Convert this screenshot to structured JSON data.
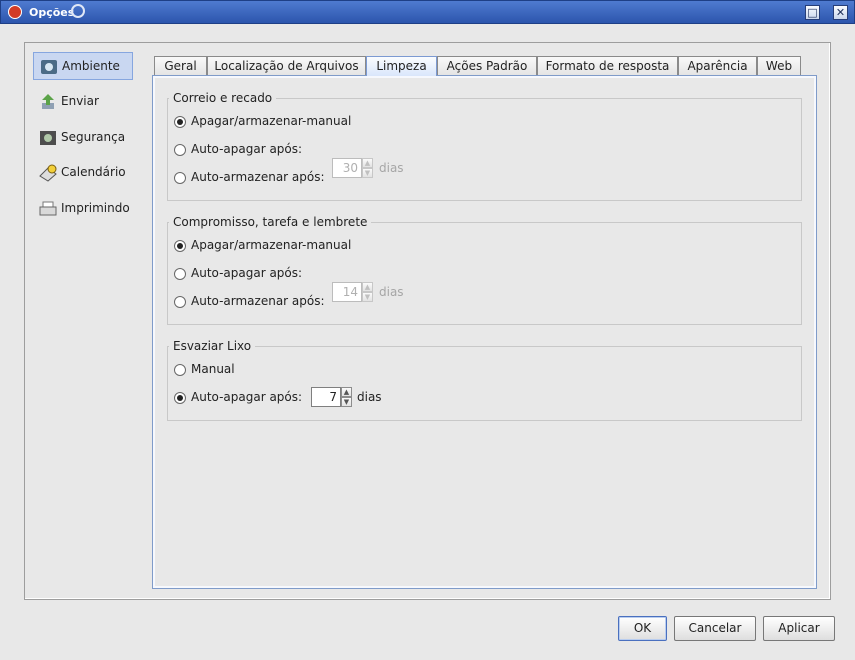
{
  "window": {
    "title": "Opções",
    "minimize_label": "□",
    "close_label": "✕"
  },
  "sidebar": {
    "items": [
      {
        "label": "Ambiente",
        "icon": "environment-icon"
      },
      {
        "label": "Enviar",
        "icon": "send-icon"
      },
      {
        "label": "Segurança",
        "icon": "security-icon"
      },
      {
        "label": "Calendário",
        "icon": "calendar-icon"
      },
      {
        "label": "Imprimindo",
        "icon": "printer-icon"
      }
    ]
  },
  "tabs": [
    {
      "label": "Geral"
    },
    {
      "label": "Localização de Arquivos"
    },
    {
      "label": "Limpeza"
    },
    {
      "label": "Ações Padrão"
    },
    {
      "label": "Formato de resposta"
    },
    {
      "label": "Aparência"
    },
    {
      "label": "Web"
    }
  ],
  "groups": {
    "mail": {
      "title": "Correio e recado",
      "manual": "Apagar/armazenar-manual",
      "auto_delete": "Auto-apagar após:",
      "auto_store": "Auto-armazenar após:",
      "value": "30",
      "unit": "dias"
    },
    "appointments": {
      "title": "Compromisso, tarefa e lembrete",
      "manual": "Apagar/armazenar-manual",
      "auto_delete": "Auto-apagar após:",
      "auto_store": "Auto-armazenar após:",
      "value": "14",
      "unit": "dias"
    },
    "trash": {
      "title": "Esvaziar Lixo",
      "manual": "Manual",
      "auto_delete": "Auto-apagar após:",
      "value": "7",
      "unit": "dias"
    }
  },
  "buttons": {
    "ok": "OK",
    "cancel": "Cancelar",
    "apply": "Aplicar"
  },
  "colors": {
    "titlebar": "#2c55ad",
    "selected_sidebar": "#c9d7f1",
    "active_tab": "#d9e6fb"
  }
}
